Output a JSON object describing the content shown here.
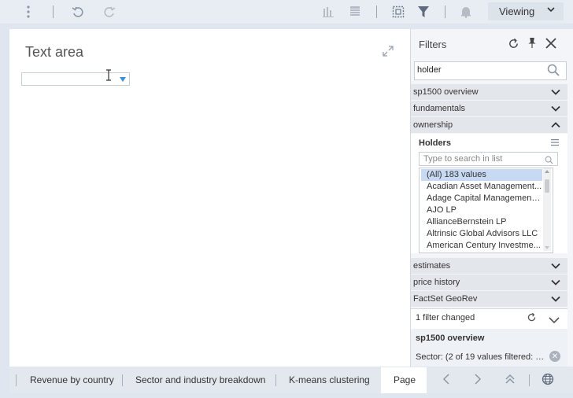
{
  "toolbar": {
    "icons": [
      "more-vertical-icon",
      "undo-icon",
      "redo-icon",
      "bar-chart-icon",
      "table-icon",
      "select-icon",
      "filter-icon",
      "bell-icon"
    ],
    "mode_label": "Viewing",
    "accent": "#3b8fd6"
  },
  "canvas": {
    "title": "Text area",
    "dropdown_value": ""
  },
  "filters": {
    "title": "Filters",
    "search_value": "holder",
    "sections_top": [
      "sp1500 overview",
      "fundamentals",
      "ownership"
    ],
    "holders": {
      "label": "Holders",
      "search_placeholder": "Type to search in list",
      "items": [
        "(All) 183 values",
        "Acadian Asset Management...",
        "Adage Capital Management ...",
        "AJO LP",
        "AllianceBernstein LP",
        "Altrinsic Global Advisors LLC",
        "American Century Investme..."
      ]
    },
    "sections_bottom": [
      "estimates",
      "price history",
      "FactSet GeoRev"
    ],
    "changed": {
      "summary": "1 filter changed",
      "group": "sp1500 overview",
      "detail": "Sector: (2 of 19 values filtered: C..."
    }
  },
  "tabs": {
    "items": [
      "Revenue by country",
      "Sector and industry breakdown",
      "K-means clustering",
      "Page"
    ],
    "active": "Page"
  }
}
